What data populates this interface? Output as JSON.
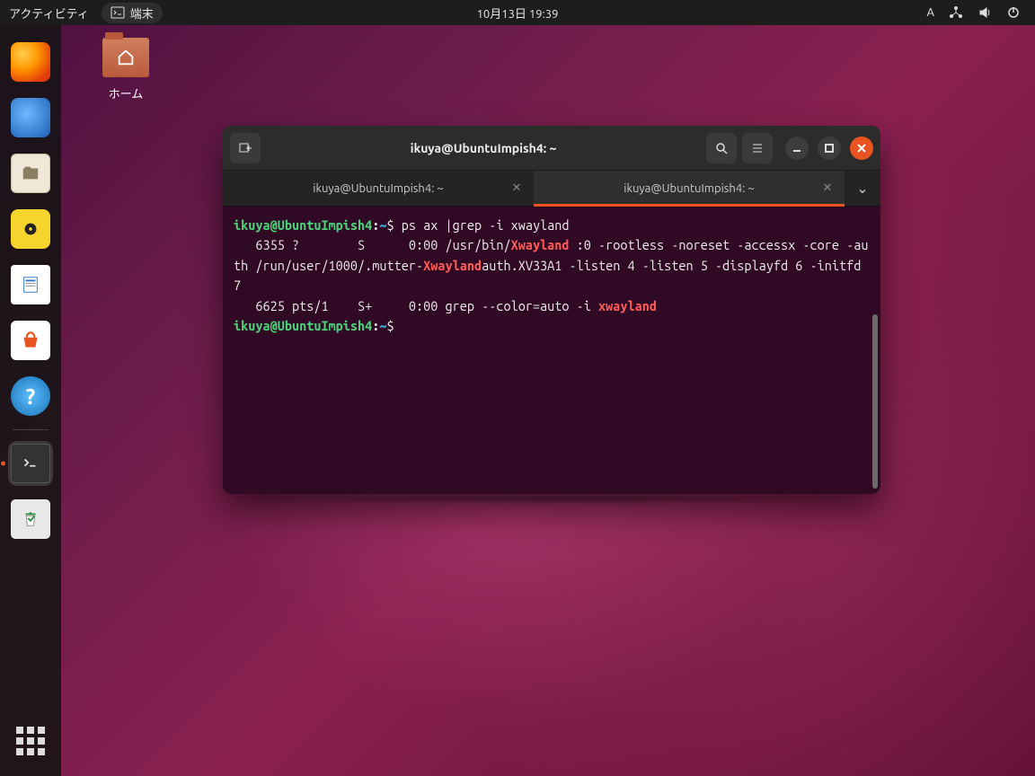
{
  "topbar": {
    "activities": "アクティビティ",
    "app_label": "端末",
    "datetime": "10月13日  19:39",
    "ime": "A"
  },
  "desktop": {
    "home_label": "ホーム"
  },
  "dock": {
    "items": [
      {
        "name": "firefox"
      },
      {
        "name": "thunderbird"
      },
      {
        "name": "files"
      },
      {
        "name": "rhythmbox"
      },
      {
        "name": "writer"
      },
      {
        "name": "software"
      },
      {
        "name": "help"
      },
      {
        "name": "terminal"
      },
      {
        "name": "trash"
      }
    ]
  },
  "terminal": {
    "title": "ikuya@UbuntuImpish4: ~",
    "tabs": [
      {
        "label": "ikuya@UbuntuImpish4: ~",
        "active": false
      },
      {
        "label": "ikuya@UbuntuImpish4: ~",
        "active": true
      }
    ],
    "prompt": {
      "user_host": "ikuya@UbuntuImpish4",
      "path": "~",
      "symbol": "$"
    },
    "command": "ps ax |grep -i xwayland",
    "output": [
      {
        "t": "   6355 ?        S      0:00 /usr/bin/"
      },
      {
        "t": "Xwayland",
        "hl": true
      },
      {
        "t": " :0 -rootless -noreset -accessx -core -auth /run/user/1000/.mutter-"
      },
      {
        "t": "Xwayland",
        "hl": true
      },
      {
        "t": "auth.XV33A1 -listen 4 -listen 5 -displayfd 6 -initfd 7\n"
      },
      {
        "t": "   6625 pts/1    S+     0:00 grep --color=auto -i "
      },
      {
        "t": "xwayland",
        "hl": true
      }
    ]
  }
}
